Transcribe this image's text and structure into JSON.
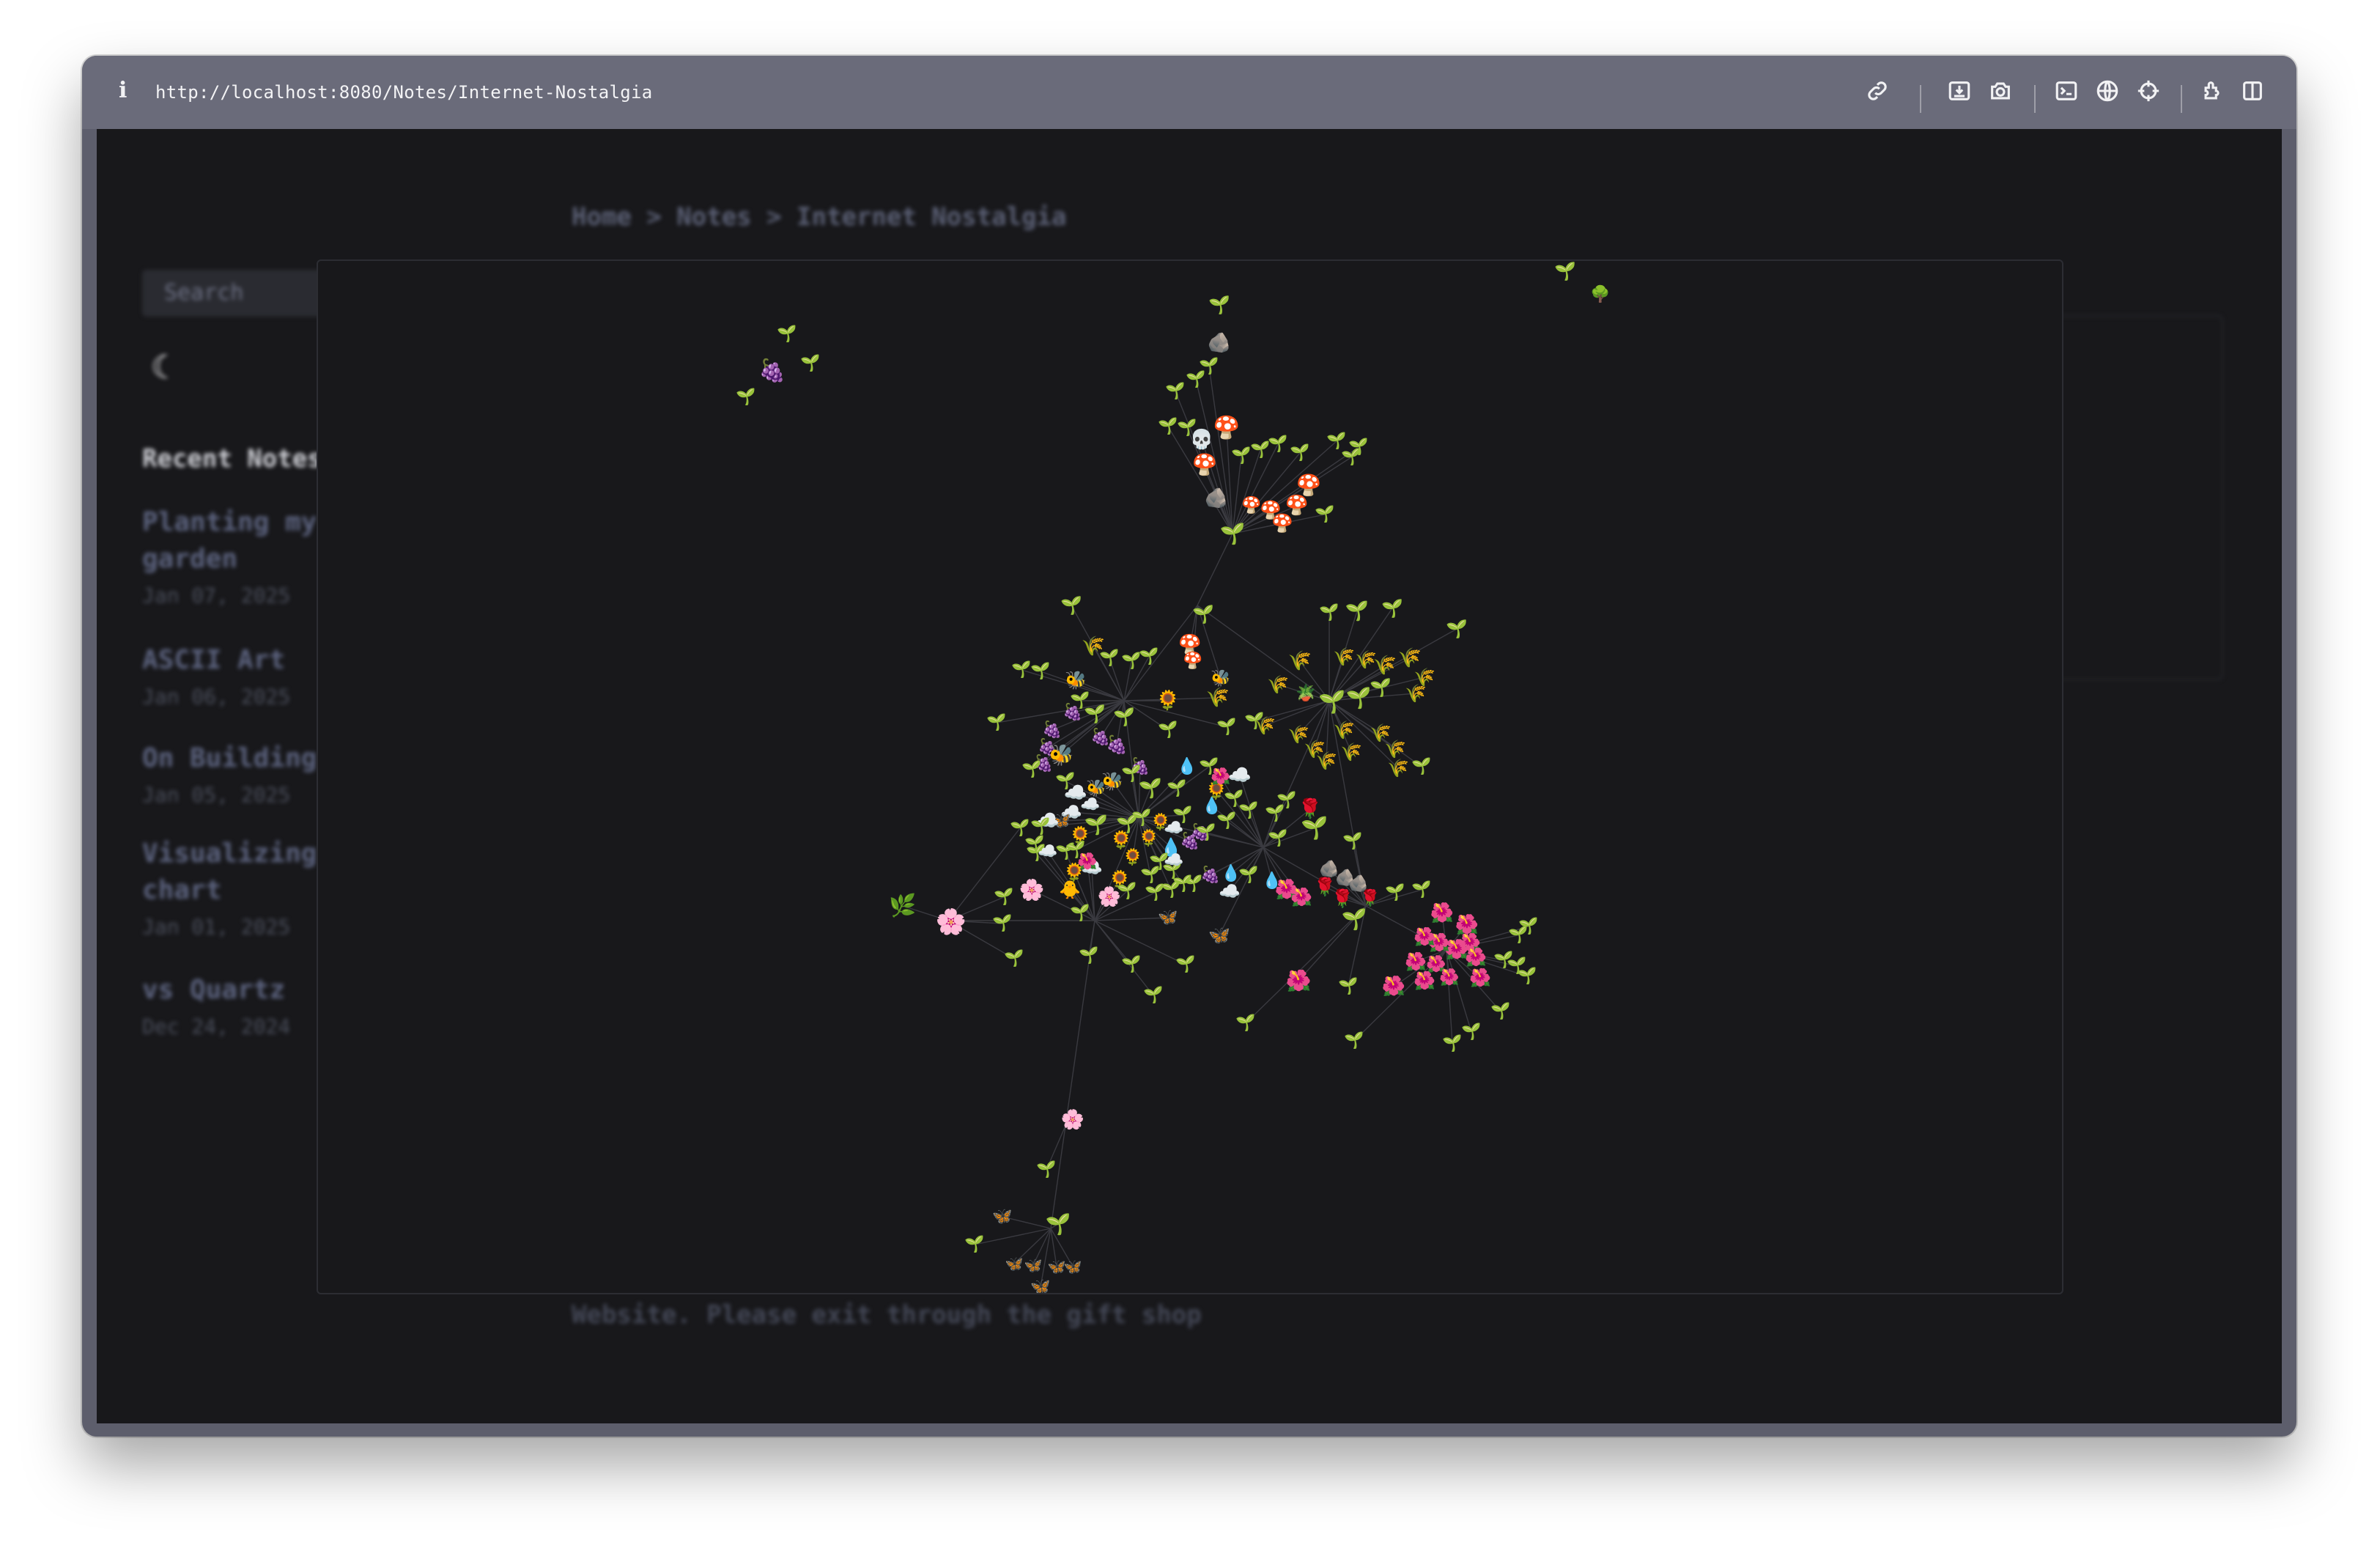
{
  "browser": {
    "info_icon": "info-icon",
    "url": "http://localhost:8080/Notes/Internet-Nostalgia",
    "toolbar_icons": [
      "link-icon",
      "download-icon",
      "camera-icon",
      "terminal-icon",
      "globe-icon",
      "crosshair-icon",
      "extension-icon",
      "sidebar-icon"
    ]
  },
  "page": {
    "breadcrumb": "Home > Notes > Internet Nostalgia",
    "search_placeholder": "Search",
    "theme_icon": "moon-icon",
    "recent_notes_title": "Recent Notes",
    "recent_notes": [
      {
        "title": "Planting my garden",
        "date": "Jan 07, 2025"
      },
      {
        "title": "ASCII Art",
        "date": "Jan 06, 2025"
      },
      {
        "title": "On Building",
        "date": "Jan 05, 2025"
      },
      {
        "title": "Visualizing chart",
        "date": "Jan 01, 2025"
      },
      {
        "title": "vs Quartz",
        "date": "Dec 24, 2024"
      }
    ],
    "footer": "Website. Please exit through the gift shop"
  },
  "graph": {
    "edge_color": "#3a3a40",
    "background": "#18181b",
    "node_glyphs": {
      "sprout": "🌱",
      "mushroom": "🍄",
      "skull": "💀",
      "rock": "🪨",
      "wheat": "🌾",
      "bee": "🐝",
      "sunflower": "🌻",
      "grapes": "🍇",
      "droplet": "💧",
      "cloud": "☁️",
      "blossom": "🌸",
      "rose": "🌹",
      "hibiscus": "🌺",
      "butterfly": "🦋",
      "tree": "🌳",
      "chick": "🐥",
      "herb": "🌿",
      "pot": "🪴"
    }
  }
}
